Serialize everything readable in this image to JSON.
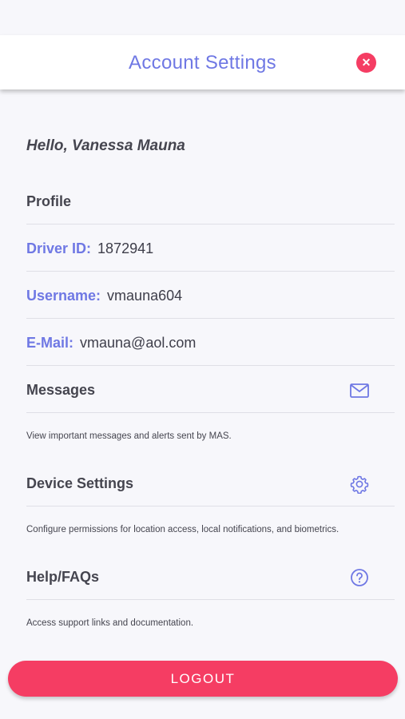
{
  "header": {
    "title": "Account Settings",
    "close_icon": "close-icon"
  },
  "greeting": "Hello, Vanessa Mauna",
  "profile": {
    "heading": "Profile",
    "driver_id_label": "Driver ID:",
    "driver_id_value": "1872941",
    "username_label": "Username:",
    "username_value": "vmauna604",
    "email_label": "E-Mail:",
    "email_value": "vmauna@aol.com"
  },
  "messages": {
    "label": "Messages",
    "icon": "envelope-icon",
    "description": "View important messages and alerts sent by MAS."
  },
  "device_settings": {
    "label": "Device Settings",
    "icon": "gear-icon",
    "description": "Configure permissions for location access, local notifications, and biometrics."
  },
  "help": {
    "label": "Help/FAQs",
    "icon": "question-circle-icon",
    "description": "Access support links and documentation."
  },
  "logout_label": "LOGOUT",
  "colors": {
    "accent": "#6f78e4",
    "danger": "#f53d63",
    "background": "#f7f7fb"
  }
}
